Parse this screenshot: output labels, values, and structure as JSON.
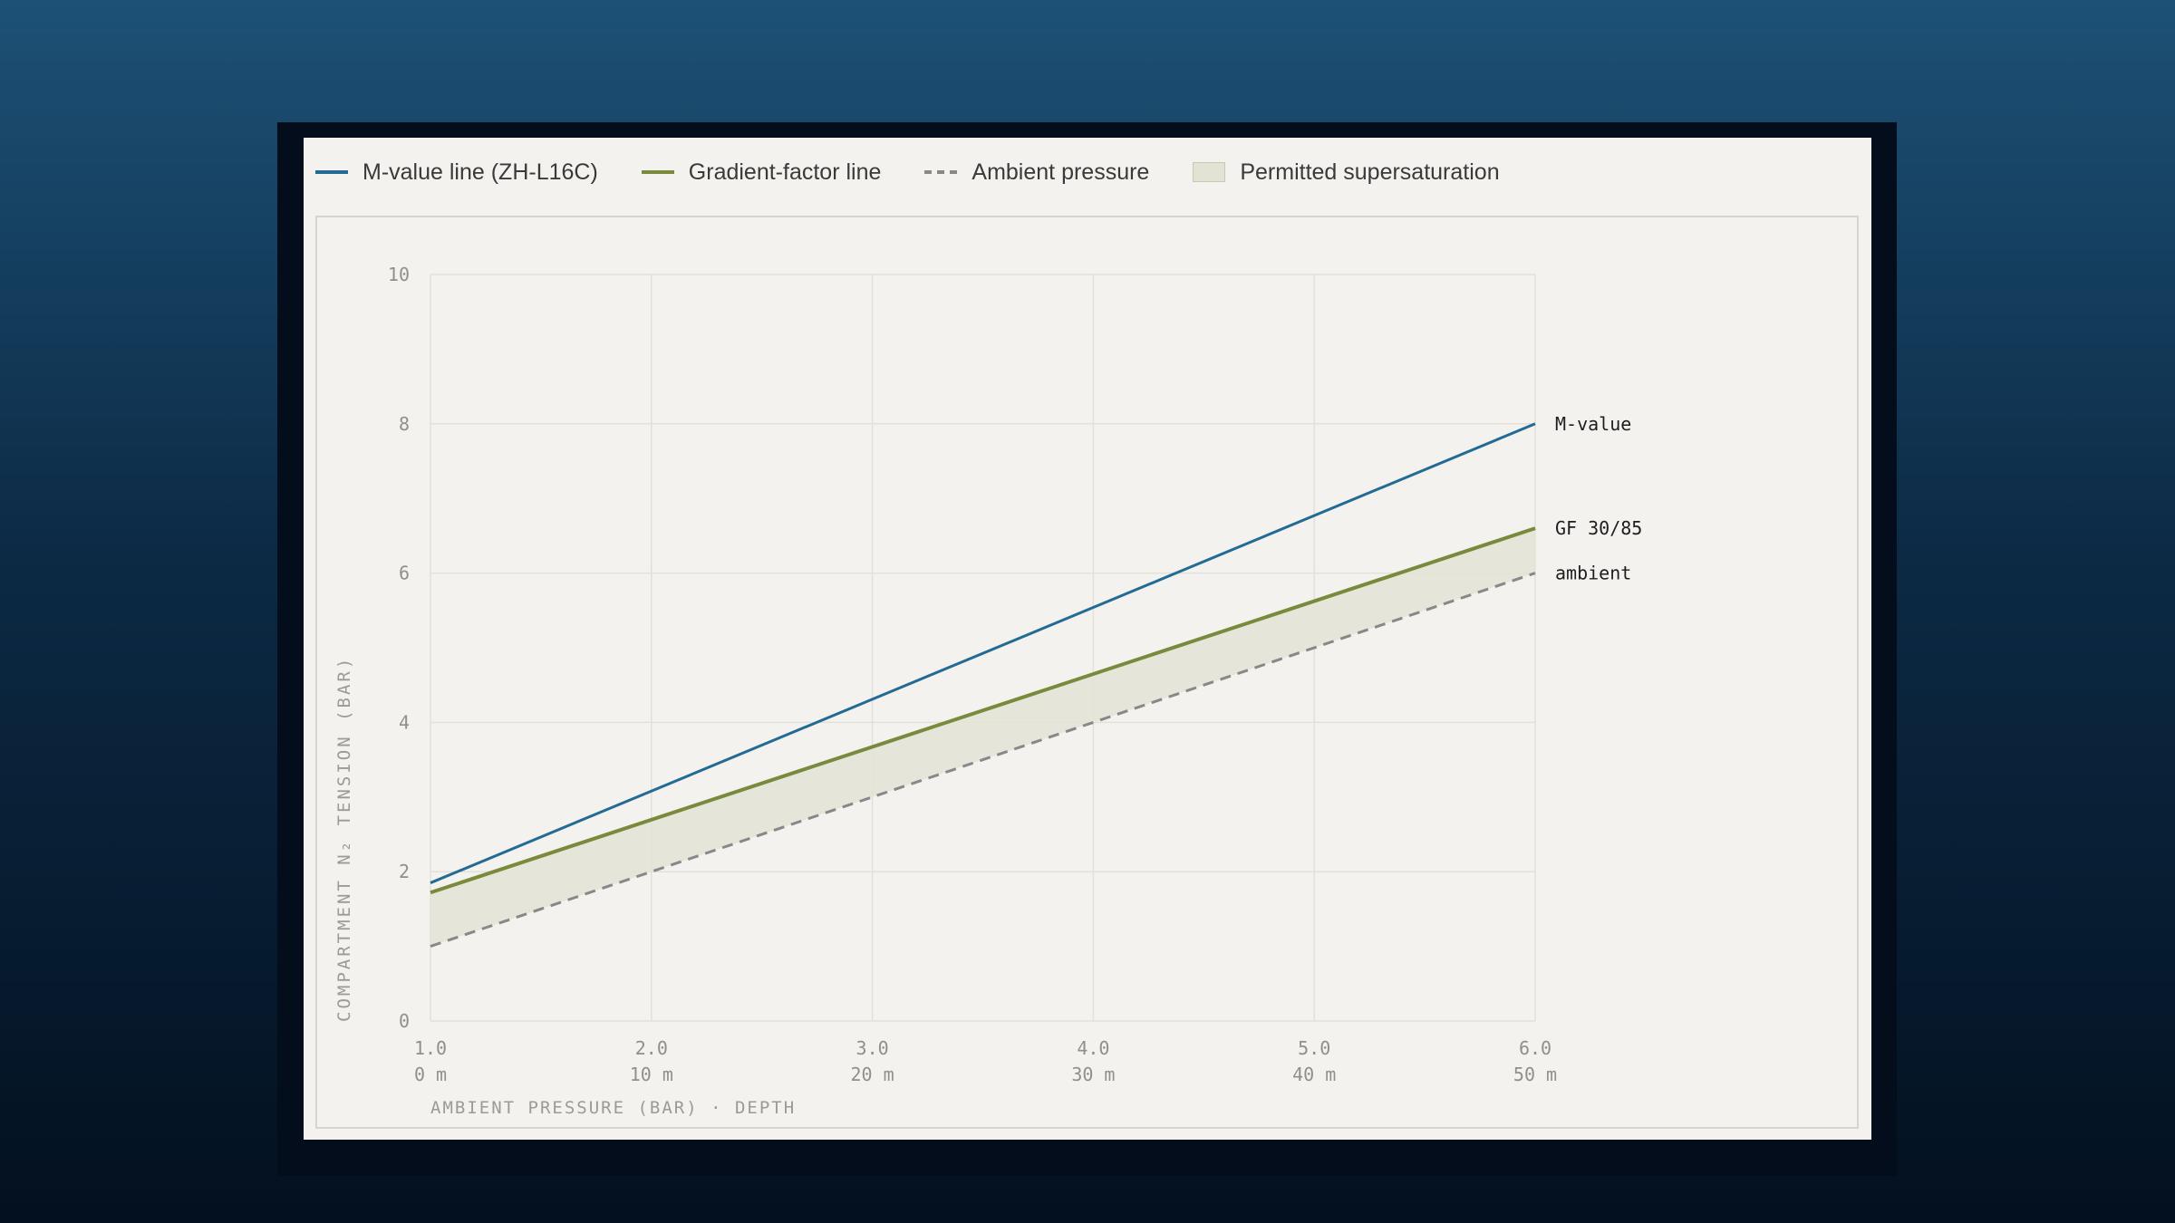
{
  "legend": {
    "items": [
      {
        "label": "M-value line (ZH-L16C)",
        "swatch": "line",
        "color": "#236b94"
      },
      {
        "label": "Gradient-factor line",
        "swatch": "line",
        "color": "#7a8a3d"
      },
      {
        "label": "Ambient pressure",
        "swatch": "dash",
        "color": "#888888"
      },
      {
        "label": "Permitted supersaturation",
        "swatch": "box",
        "color": "#e3e3d5"
      }
    ]
  },
  "chart_data": {
    "type": "line",
    "title": "",
    "xlabel": "AMBIENT PRESSURE (BAR) · DEPTH",
    "ylabel": "COMPARTMENT N₂ TENSION (BAR)",
    "xlim": [
      1.0,
      6.0
    ],
    "ylim": [
      0,
      10
    ],
    "x_ticks": [
      {
        "value": 1.0,
        "label": "1.0",
        "depth": "0 m"
      },
      {
        "value": 2.0,
        "label": "2.0",
        "depth": "10 m"
      },
      {
        "value": 3.0,
        "label": "3.0",
        "depth": "20 m"
      },
      {
        "value": 4.0,
        "label": "4.0",
        "depth": "30 m"
      },
      {
        "value": 5.0,
        "label": "5.0",
        "depth": "40 m"
      },
      {
        "value": 6.0,
        "label": "6.0",
        "depth": "50 m"
      }
    ],
    "y_ticks": [
      0,
      2,
      4,
      6,
      8,
      10
    ],
    "grid": true,
    "legend_position": "top-left",
    "series": [
      {
        "name": "M-value line (ZH-L16C)",
        "end_label": "M-value",
        "style": "solid",
        "color": "#236b94",
        "x": [
          1.0,
          6.0
        ],
        "y": [
          1.85,
          8.0
        ]
      },
      {
        "name": "Gradient-factor line",
        "end_label": "GF 30/85",
        "style": "solid",
        "color": "#7a8a3d",
        "x": [
          1.0,
          6.0
        ],
        "y": [
          1.72,
          6.6
        ]
      },
      {
        "name": "Ambient pressure",
        "end_label": "ambient",
        "style": "dashed",
        "color": "#888888",
        "x": [
          1.0,
          6.0
        ],
        "y": [
          1.0,
          6.0
        ]
      }
    ],
    "band": {
      "name": "Permitted supersaturation",
      "between": [
        "Ambient pressure",
        "Gradient-factor line"
      ],
      "color": "#e3e3d5"
    }
  }
}
